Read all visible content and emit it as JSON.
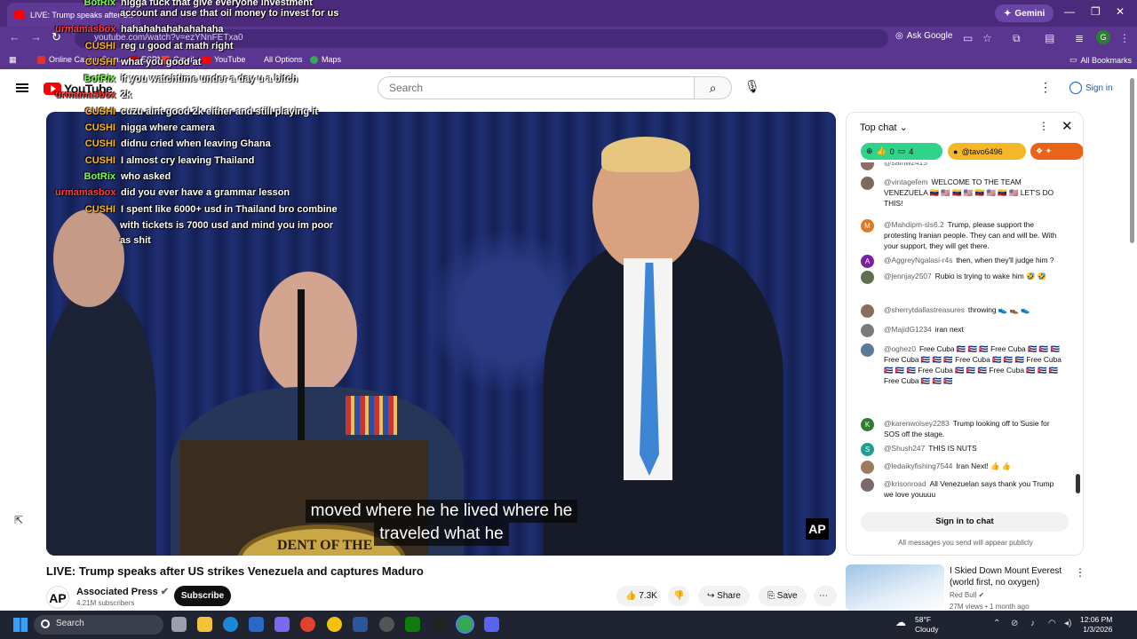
{
  "browser": {
    "tab_title": "LIVE: Trump speaks after U...",
    "gemini_label": "Gemini",
    "url": "youtube.com/watch?v=ezYNnFETxa0",
    "ask_google": "Ask Google",
    "profile_initial": "G",
    "bookmarks": [
      "Online Casino Gam...",
      "ESPN",
      "Gmail",
      "YouTube",
      "All Options",
      "Maps"
    ],
    "all_bookmarks": "All Bookmarks"
  },
  "youtube": {
    "logo": "YouTube",
    "search_placeholder": "Search",
    "sign_in": "Sign in"
  },
  "video": {
    "caption_line1": "moved where he he lived where he",
    "caption_line2": "traveled what he",
    "seal_text": "DENT OF THE",
    "watermark": "AP",
    "title": "LIVE: Trump speaks after US strikes Venezuela and captures Maduro",
    "channel": "Associated Press",
    "subscribers": "4.21M subscribers",
    "subscribe": "Subscribe",
    "likes": "7.3K",
    "share": "Share",
    "save": "Save"
  },
  "overlay_chat": [
    {
      "user": "BotRix",
      "text": "nigga fuck that give everyone investment",
      "color": "#7cff4f"
    },
    {
      "user": "",
      "text": "account and use that oil money to invest for us",
      "color": "#ffffff"
    },
    {
      "user": "urmamasbox",
      "text": "hahahahahahahahaha",
      "color": "#ff3b3b"
    },
    {
      "user": "CUSHI",
      "text": "reg u good at math right",
      "color": "#ffb428"
    },
    {
      "user": "CUSHI",
      "text": "what you good at",
      "color": "#ffb428"
    },
    {
      "user": "BotRix",
      "text": "if you watchtime under a day u a bitch",
      "color": "#7cff4f"
    },
    {
      "user": "urmamasbox",
      "text": "2k",
      "color": "#ff3b3b"
    },
    {
      "user": "CUSHI",
      "text": "cuzu aint good 2k either and still playing it",
      "color": "#ffb428"
    },
    {
      "user": "CUSHI",
      "text": "nigga where camera",
      "color": "#ffb428"
    },
    {
      "user": "CUSHI",
      "text": "didnu cried  when leaving Ghana",
      "color": "#ffb428"
    },
    {
      "user": "CUSHI",
      "text": "I almost cry leaving Thailand",
      "color": "#ffb428"
    },
    {
      "user": "BotRix",
      "text": "who asked",
      "color": "#7cff4f"
    },
    {
      "user": "urmamasbox",
      "text": "did you ever have a grammar lesson",
      "color": "#ff3b3b"
    },
    {
      "user": "CUSHI",
      "text": "I spent like 6000+ usd in Thailand bro combine",
      "color": "#ffb428"
    },
    {
      "user": "",
      "text": "with tickets is 7000 usd and mind you im poor",
      "color": "#ffffff"
    },
    {
      "user": "",
      "text": "as shit",
      "color": "#ffffff"
    }
  ],
  "live_chat": {
    "header": "Top chat",
    "pill_counts": [
      "0",
      "4"
    ],
    "pill_user": "@tavo6496",
    "messages": [
      {
        "author": "@samw2415",
        "text": "",
        "initial": "",
        "color": "#8d6e63"
      },
      {
        "author": "@vintagefem",
        "text": "WELCOME TO THE TEAM VENEZUELA 🇻🇪 🇺🇸 🇻🇪 🇺🇸 🇻🇪 🇺🇸 🇻🇪 🇺🇸 LET'S DO THIS!",
        "initial": "",
        "color": "#7d6a5e"
      },
      {
        "author": "@Mahdipm-sls6.2",
        "text": "Trump, please support the protesting Iranian people. They can and will be. With your support, they will get there.",
        "initial": "M",
        "color": "#e0791d"
      },
      {
        "author": "@AggreyNgalasi-r4s",
        "text": "then, when they'll judge him ?",
        "initial": "A",
        "color": "#7b1fa2"
      },
      {
        "author": "@jennjay2507",
        "text": "Rubio is trying to wake him 🤣 🤣",
        "initial": "",
        "color": "#5d7050"
      },
      {
        "author": "@sherrytdallastreasures",
        "text": "throwing 👟 👞 👟",
        "initial": "",
        "color": "#8a6d5b"
      },
      {
        "author": "@MajidG1234",
        "text": "iran next",
        "initial": "",
        "color": "#7a7a7a"
      },
      {
        "author": "@oghez0",
        "text": "Free Cuba 🇨🇺 🇨🇺 🇨🇺 Free Cuba 🇨🇺 🇨🇺 🇨🇺 Free Cuba 🇨🇺 🇨🇺 🇨🇺 Free Cuba 🇨🇺 🇨🇺 🇨🇺 Free Cuba 🇨🇺 🇨🇺 🇨🇺 Free Cuba 🇨🇺 🇨🇺 🇨🇺 Free Cuba 🇨🇺 🇨🇺 🇨🇺 Free Cuba 🇨🇺 🇨🇺 🇨🇺",
        "initial": "",
        "color": "#5b7a9a"
      },
      {
        "author": "@karenwolsey2283",
        "text": "Trump looking off to Susie for SOS off the stage.",
        "initial": "K",
        "color": "#2e7d32"
      },
      {
        "author": "@Shush247",
        "text": "THIS IS NUTS",
        "initial": "S",
        "color": "#1e9e8e"
      },
      {
        "author": "@ledaikyfishing7544",
        "text": "Iran Next! 👍 👍",
        "initial": "",
        "color": "#9a7b60"
      },
      {
        "author": "@krisonroad",
        "text": "All Venezuelan says thank you Trump we love youuuu",
        "initial": "",
        "color": "#7a6a6a"
      }
    ],
    "sign_in_chat": "Sign in to chat",
    "note": "All messages you send will appear publicly"
  },
  "recommendation": {
    "title": "I Skied Down Mount Everest (world first, no oxygen)",
    "channel": "Red Bull",
    "meta": "27M views • 1 month ago"
  },
  "taskbar": {
    "search": "Search",
    "weather_temp": "58°F",
    "weather_desc": "Cloudy",
    "time": "12:06 PM",
    "date": "1/3/2026"
  }
}
